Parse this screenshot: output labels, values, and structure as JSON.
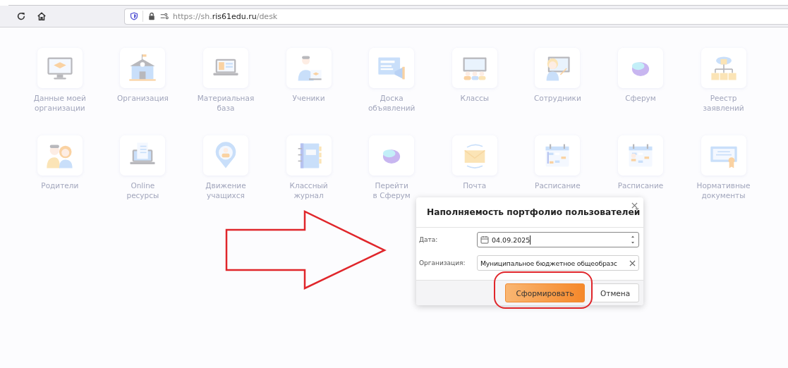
{
  "browser": {
    "url_host_prefix": "https://sh.",
    "url_host": "ris61edu.ru",
    "url_path": "/desk"
  },
  "tiles": [
    {
      "label": "Данные моей\nорганизации"
    },
    {
      "label": "Организация"
    },
    {
      "label": "Материальная\nбаза"
    },
    {
      "label": "Ученики"
    },
    {
      "label": "Доска\nобъявлений"
    },
    {
      "label": "Классы"
    },
    {
      "label": "Сотрудники"
    },
    {
      "label": "Сферум"
    },
    {
      "label": "Реестр\nзаявлений"
    },
    {
      "label": "Родители"
    },
    {
      "label": "Online\nресурсы"
    },
    {
      "label": "Движение\nучащихся"
    },
    {
      "label": "Классный\nжурнал"
    },
    {
      "label": "Перейти\nв Сферум"
    },
    {
      "label": "Почта"
    },
    {
      "label": "Расписание"
    },
    {
      "label": "Расписание"
    },
    {
      "label": "Нормативные\nдокументы"
    }
  ],
  "dialog": {
    "title": "Наполняемость портфолио пользователей",
    "fields": [
      {
        "kind": "date",
        "label": "Дата:",
        "value": "04.09.2025"
      },
      {
        "kind": "select",
        "label": "Организация:",
        "value": "Муниципальное бюджетное общеобразс"
      }
    ],
    "buttons": [
      {
        "kind": "primary",
        "label": "Сформировать"
      },
      {
        "kind": "secondary",
        "label": "Отмена"
      }
    ]
  }
}
